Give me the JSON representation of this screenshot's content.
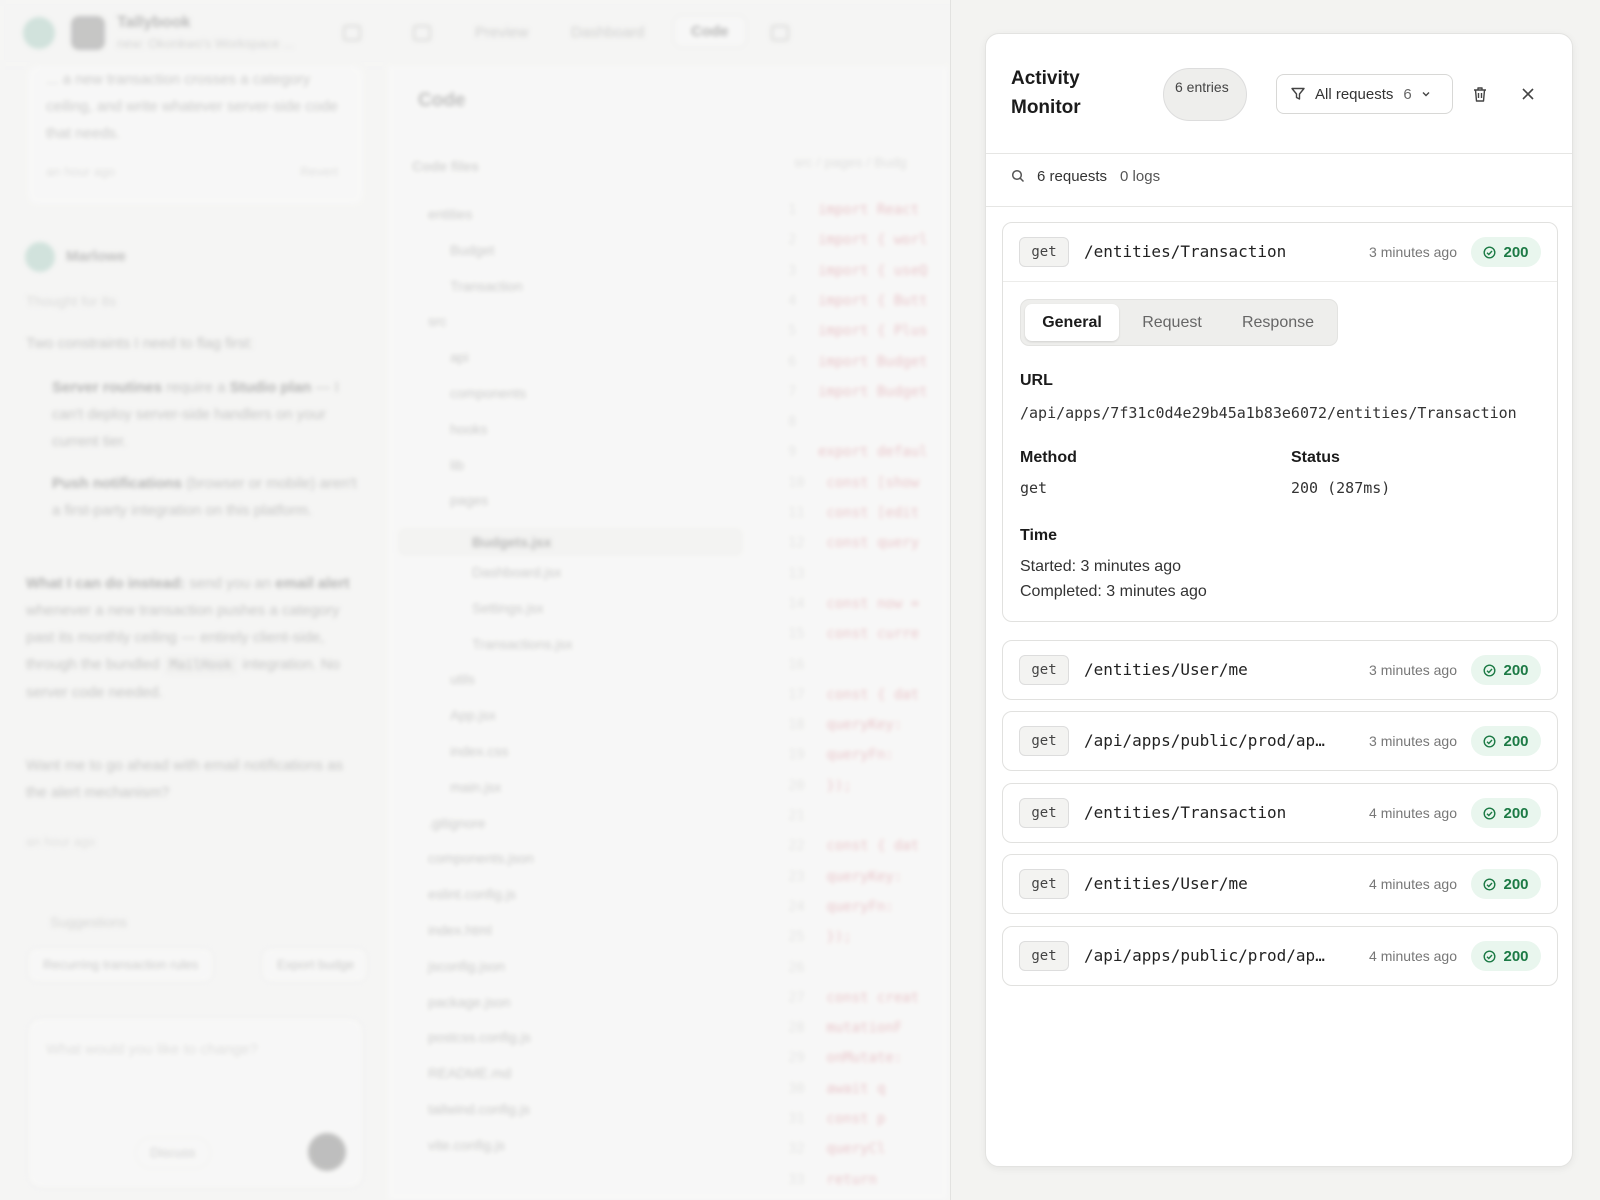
{
  "background": {
    "app_title": "Tallybook",
    "app_subtitle": "new: Okonkwo's Workspace ...",
    "tabs": [
      "Preview",
      "Dashboard",
      "Code"
    ],
    "chat_card_text": "... a new transaction crosses a category ceiling, and write whatever server-side code that needs.",
    "chat_card_time": "an hour ago",
    "chat_card_revert": "Revert",
    "bot_name": "Marlowe",
    "thought": "Thought for 8s",
    "intro": "Two constraints I need to flag first:",
    "point1_a": "Server routines",
    "point1_b": " require a ",
    "point1_c": "Studio plan",
    "point1_d": " — I can't deploy server-side handlers on your current tier.",
    "point2_a": "Push notifications",
    "point2_b": " (browser or mobile) aren't a first-party integration on this platform.",
    "alt_a": "What I can do instead:",
    "alt_b": " send you an ",
    "alt_c": "email alert",
    "alt_d": " whenever a new transaction pushes a category past its monthly ceiling — entirely client-side, through the bundled ",
    "alt_code": "MailHook",
    "alt_e": " integration. No server code needed.",
    "question": "Want me to go ahead with email notifications as the alert mechanism?",
    "answer_time": "an hour ago",
    "suggestions_label": "Suggestions",
    "suggestions": [
      "Recurring transaction rules",
      "Export budge"
    ],
    "composer_placeholder": "What would you like to change?",
    "composer_discuss": "Discuss",
    "code_title": "Code",
    "files_title": "Code files",
    "tree": [
      "entities",
      "Budget",
      "Transaction",
      "src",
      "api",
      "components",
      "hooks",
      "lib",
      "pages",
      "Budgets.jsx",
      "Dashboard.jsx",
      "Settings.jsx",
      "Transactions.jsx",
      "utils",
      "App.jsx",
      "index.css",
      "main.jsx",
      ".gitignore",
      "components.json",
      "eslint.config.js",
      "index.html",
      "jsconfig.json",
      "package.json",
      "postcss.config.js",
      "README.md",
      "tailwind.config.js",
      "vite.config.js"
    ],
    "crumb": "src / pages / Budg",
    "code_lines": [
      "import React",
      "import { worl",
      "import { useQ",
      "import { Butt",
      "import { Plus",
      "import Budget",
      "import Budget",
      "",
      "export defaul",
      "  const [show",
      "  const [edit",
      "  const query",
      "",
      "  const now =",
      "  const curre",
      "",
      "  const { dat",
      "    queryKey:",
      "    queryFn:",
      "  });",
      "",
      "  const { dat",
      "    queryKey:",
      "    queryFn:",
      "  });",
      "",
      "  const creat",
      "    mutationF",
      "    onMutate:",
      "      await q",
      "      const p",
      "      queryCl",
      "      return"
    ]
  },
  "monitor": {
    "title": "Activity Monitor",
    "entries_badge": "6 entries",
    "filter_label": "All requests",
    "filter_count": "6",
    "requests_count": "6 requests",
    "logs_count": "0 logs",
    "tabs": [
      "General",
      "Request",
      "Response"
    ],
    "detail": {
      "url_label": "URL",
      "url": "/api/apps/7f31c0d4e29b45a1b83e6072/entities/Transaction",
      "method_label": "Method",
      "method": "get",
      "status_label": "Status",
      "status": "200 (287ms)",
      "time_label": "Time",
      "started": "Started: 3 minutes ago",
      "completed": "Completed: 3 minutes ago"
    },
    "requests": [
      {
        "method": "get",
        "path": "/entities/Transaction",
        "time": "3 minutes ago",
        "status": "200"
      },
      {
        "method": "get",
        "path": "/entities/User/me",
        "time": "3 minutes ago",
        "status": "200"
      },
      {
        "method": "get",
        "path": "/api/apps/public/prod/app…",
        "time": "3 minutes ago",
        "status": "200"
      },
      {
        "method": "get",
        "path": "/entities/Transaction",
        "time": "4 minutes ago",
        "status": "200"
      },
      {
        "method": "get",
        "path": "/entities/User/me",
        "time": "4 minutes ago",
        "status": "200"
      },
      {
        "method": "get",
        "path": "/api/apps/public/prod/app…",
        "time": "4 minutes ago",
        "status": "200"
      }
    ],
    "colors": {
      "success": "#1c7a45",
      "success_bg": "#e9f6ee"
    }
  }
}
